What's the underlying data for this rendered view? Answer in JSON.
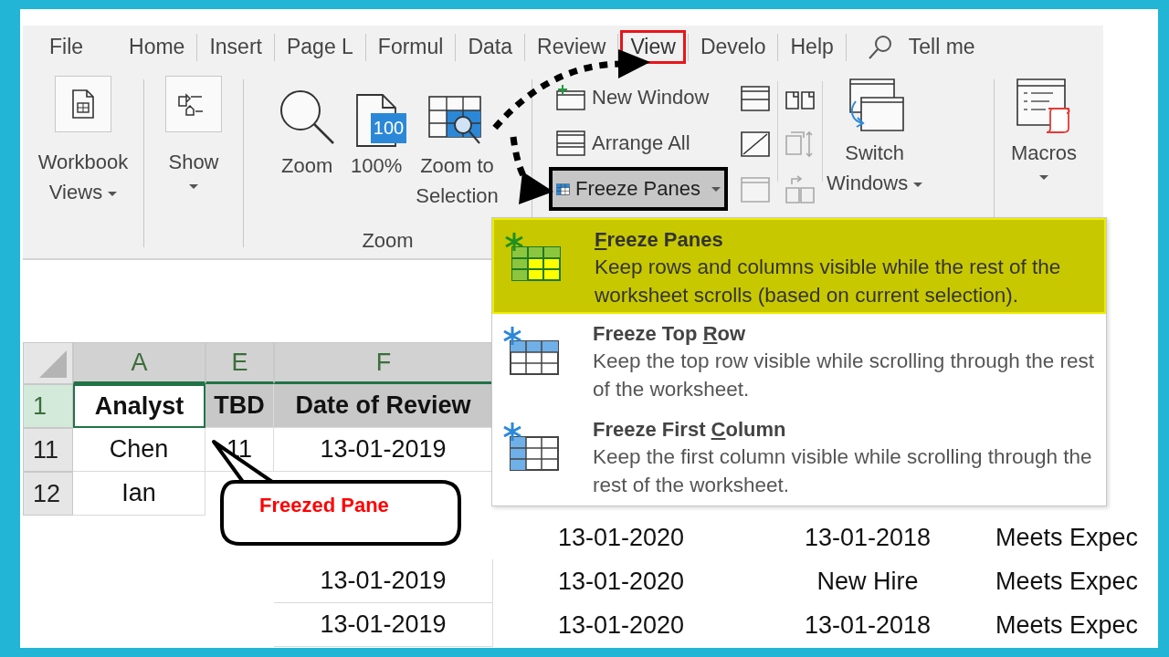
{
  "tabs": [
    {
      "label": "File",
      "selected": false
    },
    {
      "label": "Home",
      "selected": false
    },
    {
      "label": "Insert",
      "selected": false
    },
    {
      "label": "Page L",
      "selected": false
    },
    {
      "label": "Formul",
      "selected": false
    },
    {
      "label": "Data",
      "selected": false
    },
    {
      "label": "Review",
      "selected": false
    },
    {
      "label": "View",
      "selected": true
    },
    {
      "label": "Develo",
      "selected": false
    },
    {
      "label": "Help",
      "selected": false
    }
  ],
  "tell_me": {
    "placeholder": "Tell me"
  },
  "ribbon": {
    "left_buttons": [
      {
        "kind": "workbook-views",
        "label_lines": [
          "Workbook",
          "Views"
        ],
        "dropdown": true
      },
      {
        "kind": "show",
        "label_lines": [
          "Show"
        ],
        "dropdown": true
      }
    ],
    "zoom_group": {
      "label": "Zoom",
      "buttons": [
        {
          "kind": "zoom",
          "label_lines": [
            "Zoom"
          ]
        },
        {
          "kind": "zoom-100",
          "label_lines": [
            "100%"
          ],
          "badge": "100"
        },
        {
          "kind": "zoom-selection",
          "label_lines": [
            "Zoom to",
            "Selection"
          ]
        }
      ]
    },
    "window_group": {
      "commands": [
        {
          "kind": "new-window",
          "label": "New Window",
          "dropdown": false,
          "highlighted": false
        },
        {
          "kind": "arrange-all",
          "label": "Arrange All",
          "dropdown": false,
          "highlighted": false
        },
        {
          "kind": "freeze-panes",
          "label": "Freeze Panes",
          "dropdown": true,
          "highlighted": true
        }
      ],
      "icons": [
        {
          "kind": "split",
          "disabled": false
        },
        {
          "kind": "hide",
          "disabled": false
        },
        {
          "kind": "unhide",
          "disabled": true
        },
        {
          "kind": "side-by-side",
          "disabled": false
        },
        {
          "kind": "sync-scroll",
          "disabled": true
        },
        {
          "kind": "reset-position",
          "disabled": true
        }
      ],
      "switch_windows": {
        "label_lines": [
          "Switch",
          "Windows"
        ],
        "dropdown": true
      }
    },
    "macros": {
      "label_lines": [
        "Macros"
      ],
      "dropdown": true
    }
  },
  "freeze_menu": [
    {
      "kind": "panes",
      "selected": true,
      "key": "F",
      "title_end": "reeze Panes",
      "description": "Keep rows and columns visible while the rest of the worksheet scrolls (based on current selection)."
    },
    {
      "kind": "top-row",
      "selected": false,
      "title_start": "Freeze Top ",
      "key": "R",
      "title_end": "ow",
      "description": "Keep the top row visible while scrolling through the rest of the worksheet."
    },
    {
      "kind": "first-column",
      "selected": false,
      "title_start": "Freeze First ",
      "key": "C",
      "title_end": "olumn",
      "description": "Keep the first column visible while scrolling through the rest of the worksheet."
    }
  ],
  "sheet": {
    "columns": [
      {
        "label": "A",
        "selected": true
      },
      {
        "label": "E",
        "selected": true
      },
      {
        "label": "F",
        "selected": true
      }
    ],
    "rows": [
      {
        "header": "1",
        "kind": "header",
        "selected": true,
        "cells": [
          "Analyst",
          "TBD",
          "Date of Review",
          null,
          null,
          null
        ]
      },
      {
        "header": "11",
        "kind": "data",
        "selected": false,
        "cells": [
          "Chen",
          "11",
          "13-01-2019",
          null,
          null,
          null
        ]
      },
      {
        "header": "12",
        "kind": "data",
        "selected": false,
        "cells": [
          "Ian",
          null,
          null,
          null,
          null,
          null
        ]
      },
      {
        "kind": "data",
        "selected": false,
        "cells": [
          null,
          null,
          null,
          "13-01-2020",
          "13-01-2018",
          "Meets Expec"
        ]
      },
      {
        "kind": "data",
        "selected": false,
        "cells": [
          null,
          null,
          "13-01-2019",
          "13-01-2020",
          "New Hire",
          "Meets Expec"
        ]
      },
      {
        "kind": "data",
        "selected": false,
        "cells": [
          null,
          null,
          "13-01-2019",
          "13-01-2020",
          "13-01-2018",
          "Meets Expec"
        ]
      }
    ]
  },
  "callout": {
    "text": "Freezed Pane"
  }
}
